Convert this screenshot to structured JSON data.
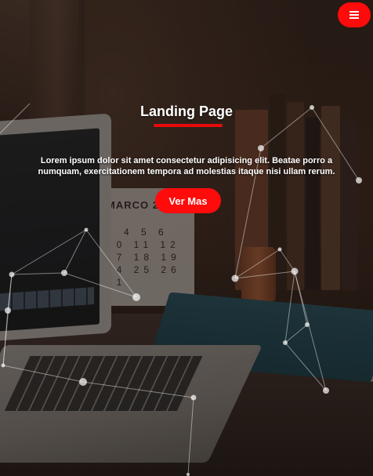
{
  "header": {
    "menu_icon": "hamburger-icon"
  },
  "hero": {
    "title": "Landing Page",
    "text": "Lorem ipsum dolor sit amet consectetur adipisicing elit. Beatae porro a numquam, exercitationem tempora ad molestias itaque nisi ullam rerum.",
    "cta_label": "Ver Mas"
  },
  "colors": {
    "accent": "#ff0b0b",
    "title_underline": "#e60b0b",
    "text": "#ffffff"
  }
}
